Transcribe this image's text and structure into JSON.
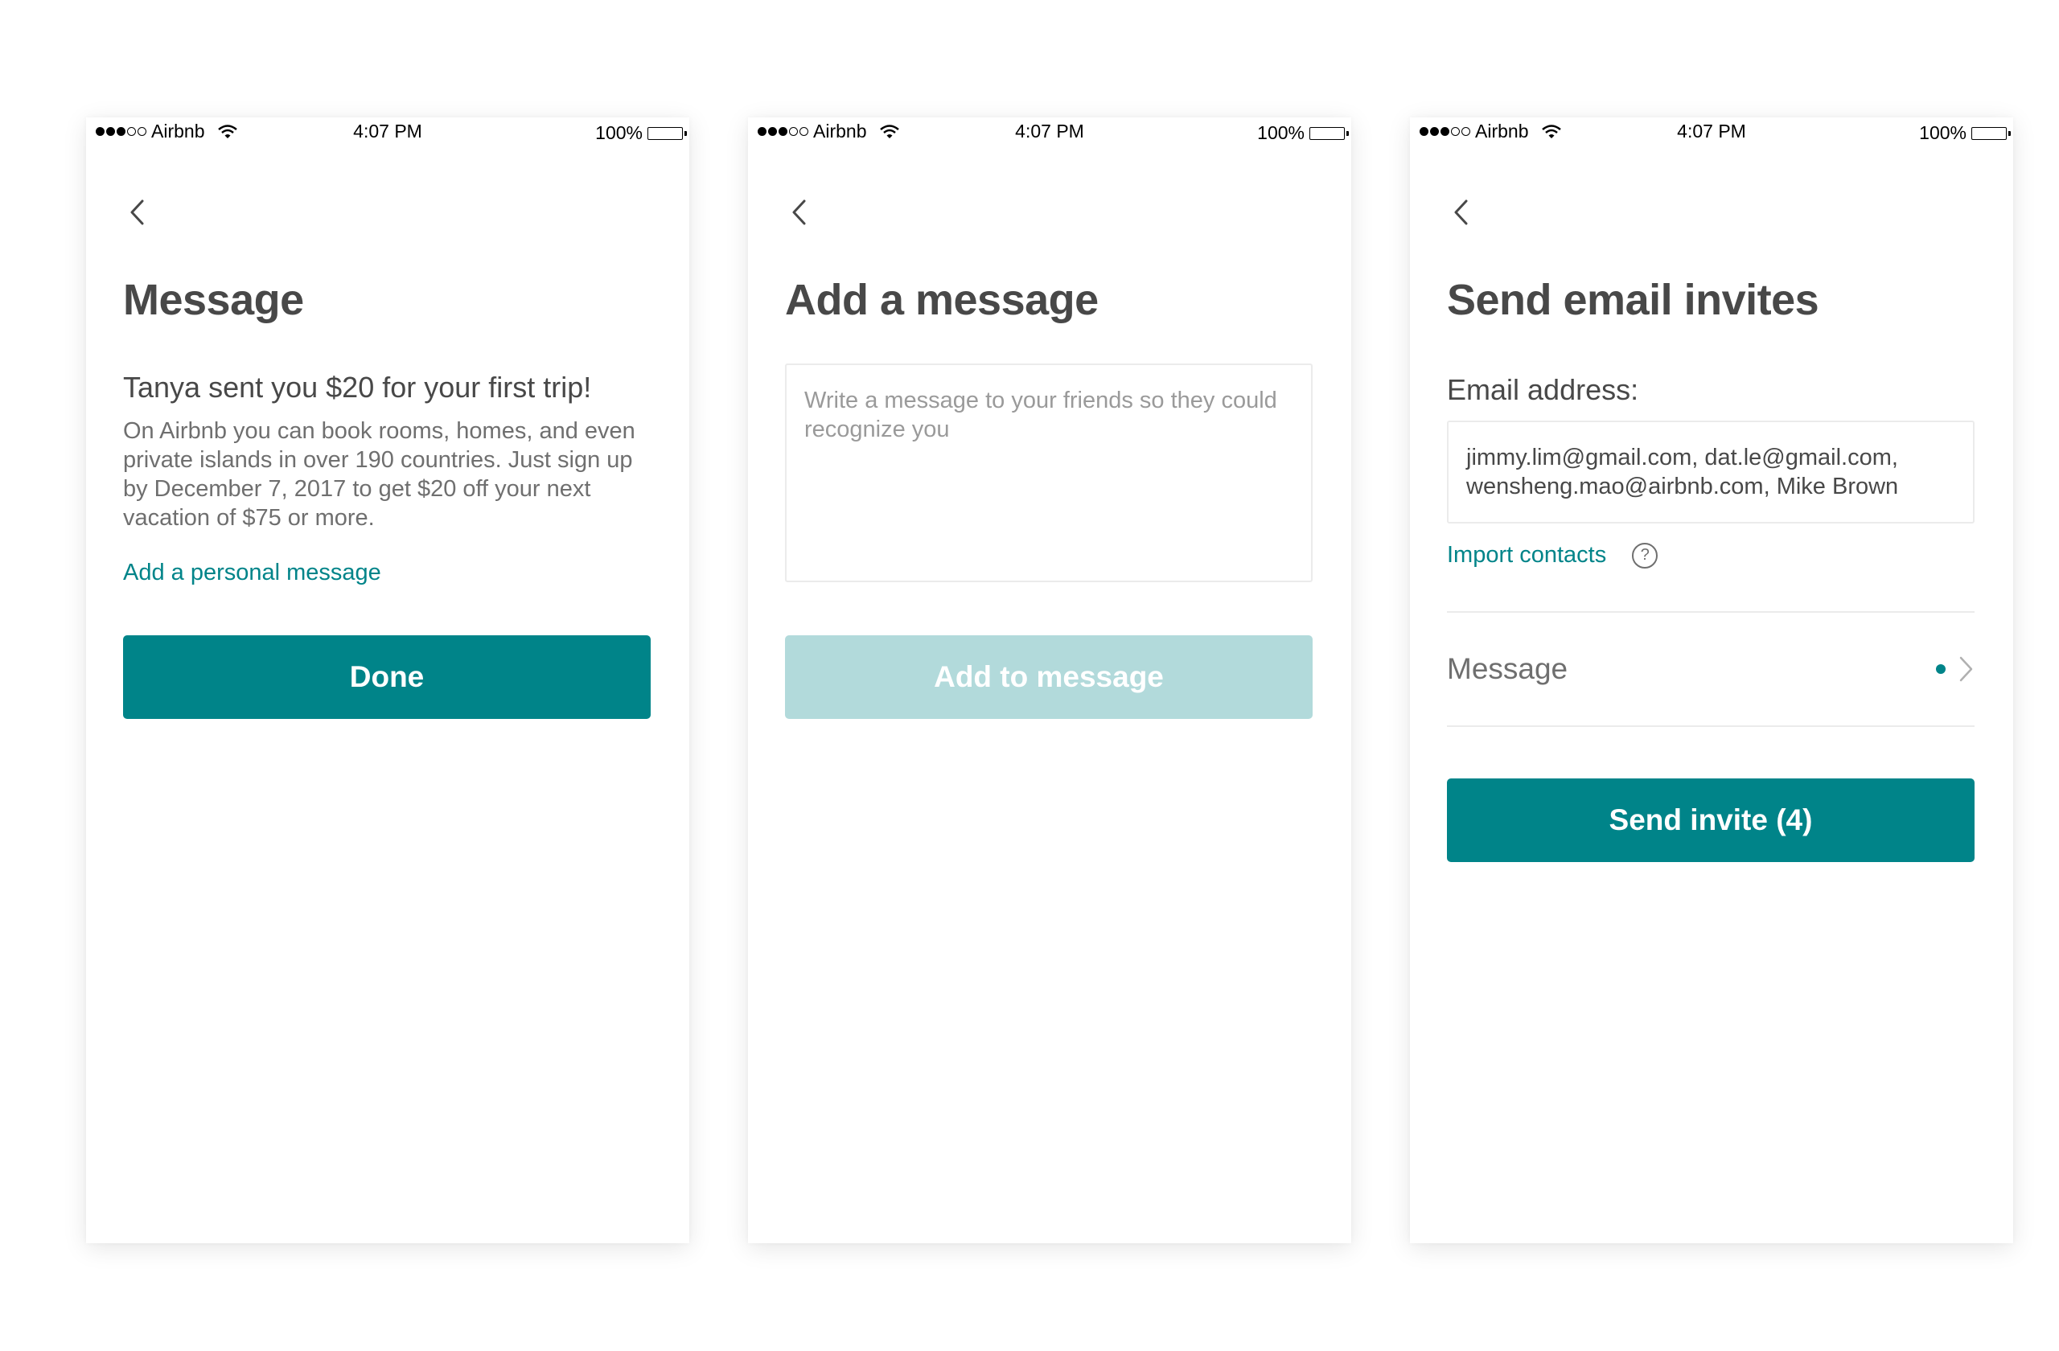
{
  "status_bar": {
    "carrier": "Airbnb",
    "time": "4:07 PM",
    "battery": "100%",
    "signal_bars_filled": 3,
    "signal_bars_total": 5
  },
  "colors": {
    "accent": "#008489",
    "accent_disabled": "#b2dadb",
    "text_primary": "#484848",
    "text_secondary": "#6f6f6f"
  },
  "screens": [
    {
      "title": "Message",
      "subheading": "Tanya sent you $20 for your first trip!",
      "body": "On Airbnb you can book rooms, homes, and even private islands in over 190 countries. Just sign up by December 7, 2017 to get $20 off your next vacation of $75 or more.",
      "link": "Add a personal message",
      "button": "Done"
    },
    {
      "title": "Add a message",
      "placeholder": "Write a message to your friends so they could recognize you",
      "button": "Add to message"
    },
    {
      "title": "Send email invites",
      "field_label": "Email address:",
      "emails": "jimmy.lim@gmail.com, dat.le@gmail.com, wensheng.mao@airbnb.com, Mike Brown",
      "import_link": "Import contacts",
      "help_icon_glyph": "?",
      "message_row_label": "Message",
      "button": "Send invite (4)"
    }
  ]
}
